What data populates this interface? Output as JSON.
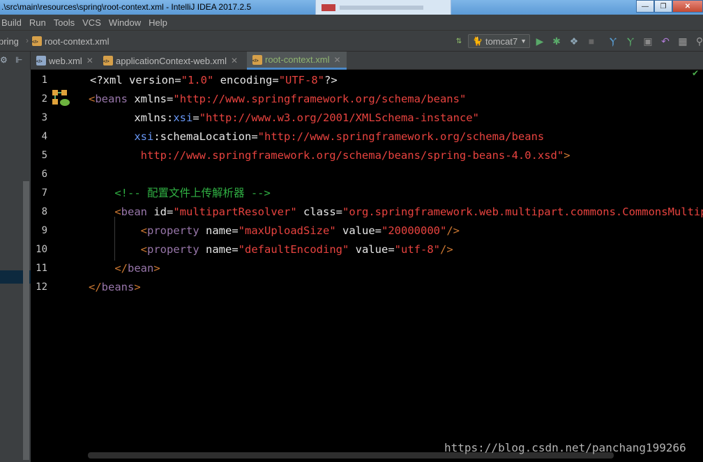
{
  "window": {
    "title": ".\\src\\main\\resources\\spring\\root-context.xml - IntelliJ IDEA 2017.2.5",
    "minimize": "—",
    "maximize": "❐",
    "close": "✕"
  },
  "menu": [
    "Build",
    "Run",
    "Tools",
    "VCS",
    "Window",
    "Help"
  ],
  "breadcrumb": {
    "project": "pring",
    "file": "root-context.xml"
  },
  "run_config": {
    "name": "tomcat7"
  },
  "panel_head": {
    "gear": "⚙",
    "collapse": "⊩"
  },
  "tabs": [
    {
      "label": "web.xml",
      "close": "✕"
    },
    {
      "label": "applicationContext-web.xml",
      "close": "✕"
    },
    {
      "label": "root-context.xml",
      "close": "✕"
    }
  ],
  "line_numbers": [
    "1",
    "2",
    "3",
    "4",
    "5",
    "6",
    "7",
    "8",
    "9",
    "10",
    "11",
    "12"
  ],
  "code": {
    "l1": {
      "open": "<?",
      "tag": "xml",
      "a1": " version",
      "v1": "\"1.0\"",
      "a2": " encoding",
      "v2": "\"UTF-8\"",
      "close": "?>"
    },
    "l2": {
      "open": "<",
      "tag": "beans",
      "a1": " xmlns",
      "v1": "\"http://www.springframework.org/schema/beans\""
    },
    "l3": {
      "ind": "       ",
      "a1": "xmlns",
      "colon": ":",
      "ns": "xsi",
      "v1": "\"http://www.w3.org/2001/XMLSchema-instance\""
    },
    "l4": {
      "ind": "       ",
      "ns": "xsi",
      "a1": ":schemaLocation",
      "v1": "\"http://www.springframework.org/schema/beans"
    },
    "l5": {
      "ind": "        ",
      "v1": "http://www.springframework.org/schema/beans/spring-beans-4.0.xsd\"",
      "close": ">"
    },
    "l7": {
      "ind": "    ",
      "cmt": "<!-- 配置文件上传解析器 -->"
    },
    "l8": {
      "ind": "    ",
      "open": "<",
      "tag": "bean",
      "a1": " id",
      "v1": "\"multipartResolver\"",
      "a2": " class",
      "v2": "\"org.springframework.web.multipart.commons.CommonsMultipartResolver\">"
    },
    "l9": {
      "ind": "        ",
      "open": "<",
      "tag": "property",
      "a1": " name",
      "v1": "\"maxUploadSize\"",
      "a2": " value",
      "v2": "\"20000000\"",
      "close": "/>"
    },
    "l10": {
      "ind": "        ",
      "open": "<",
      "tag": "property",
      "a1": " name",
      "v1": "\"defaultEncoding\"",
      "a2": " value",
      "v2": "\"utf-8\"",
      "close": "/>"
    },
    "l11": {
      "ind": "    ",
      "open": "</",
      "tag": "bean",
      "close": ">"
    },
    "l12": {
      "open": "</",
      "tag": "beans",
      "close": ">"
    }
  },
  "watermark": "https://blog.csdn.net/panchang199266",
  "colors": {
    "string": "#e8433f",
    "tag_bracket": "#cc7832",
    "tag_name": "#9876aa",
    "comment": "#30b043",
    "namespace": "#6897f5"
  }
}
